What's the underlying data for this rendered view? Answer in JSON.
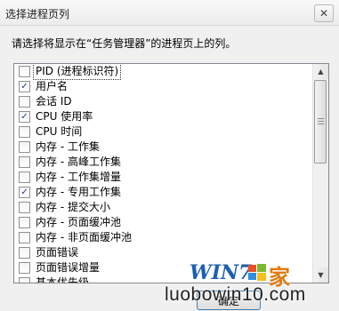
{
  "dialog": {
    "title": "选择进程页列",
    "close_label": "✕",
    "instruction": "请选择将显示在“任务管理器”的进程页上的列。",
    "ok_label": "确定"
  },
  "columns": [
    {
      "label": "PID (进程标识符)",
      "checked": false,
      "focused": true
    },
    {
      "label": "用户名",
      "checked": true
    },
    {
      "label": "会话 ID",
      "checked": false
    },
    {
      "label": "CPU 使用率",
      "checked": true
    },
    {
      "label": "CPU 时间",
      "checked": false
    },
    {
      "label": "内存 - 工作集",
      "checked": false
    },
    {
      "label": "内存 - 高峰工作集",
      "checked": false
    },
    {
      "label": "内存 - 工作集增量",
      "checked": false
    },
    {
      "label": "内存 - 专用工作集",
      "checked": true
    },
    {
      "label": "内存 - 提交大小",
      "checked": false
    },
    {
      "label": "内存 - 页面缓冲池",
      "checked": false
    },
    {
      "label": "内存 - 非页面缓冲池",
      "checked": false
    },
    {
      "label": "页面错误",
      "checked": false
    },
    {
      "label": "页面错误增量",
      "checked": false
    },
    {
      "label": "基本优先级",
      "checked": false
    }
  ],
  "watermark": {
    "brand": "WIN7",
    "brand_suffix": "家",
    "url": "luobowin10.com"
  },
  "colors": {
    "accent": "#3c7fb1",
    "check": "#1f3e8a",
    "watermark_blue": "#1d5fb0",
    "watermark_orange": "#e07a10"
  }
}
